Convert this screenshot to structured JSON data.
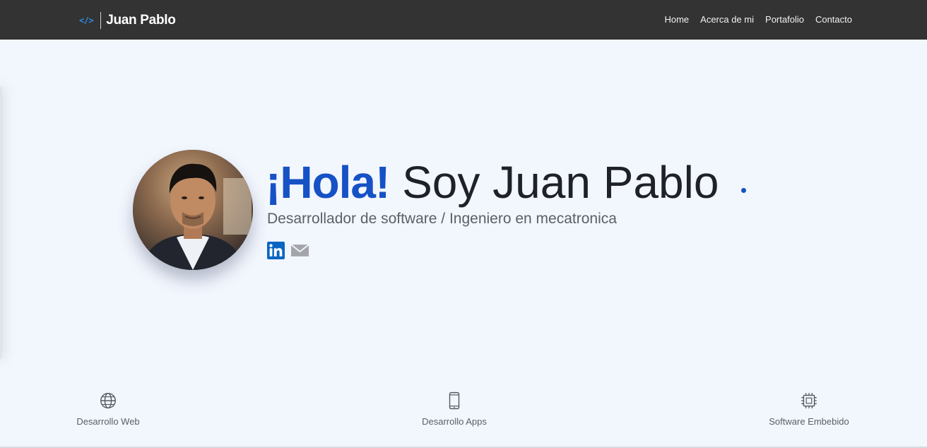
{
  "brand": {
    "icon": "</>",
    "name": "Juan Pablo"
  },
  "nav": {
    "items": [
      "Home",
      "Acerca de mi",
      "Portafolio",
      "Contacto"
    ]
  },
  "hero": {
    "greeting": "¡Hola!",
    "name": "Soy Juan Pablo",
    "subtitle": "Desarrollador de software / Ingeniero en mecatronica",
    "avatar": "profile-photo",
    "social": [
      {
        "icon": "linkedin-icon",
        "color": "#0a66c2"
      },
      {
        "icon": "email-icon",
        "color": "#9b9da3"
      }
    ]
  },
  "services": [
    {
      "icon": "globe-icon",
      "label": "Desarrollo Web"
    },
    {
      "icon": "smartphone-icon",
      "label": "Desarrollo Apps"
    },
    {
      "icon": "chip-icon",
      "label": "Software Embebido"
    }
  ],
  "colors": {
    "navbar": "#333333",
    "accent": "#1651c5",
    "background": "#f2f6fd"
  }
}
